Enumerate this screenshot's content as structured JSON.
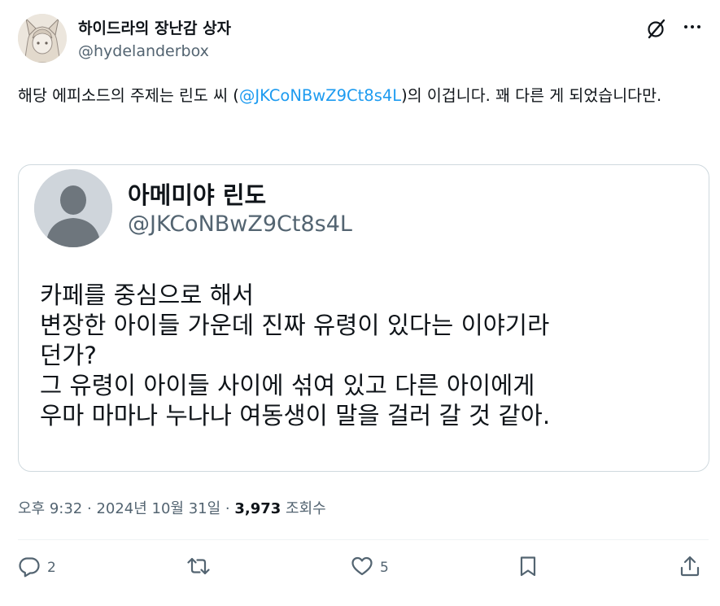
{
  "author": {
    "name": "하이드라의 장난감 상자",
    "handle": "@hydelanderbox"
  },
  "tweet": {
    "text_before": "해당 에피소드의 주제는 린도 씨 (",
    "mention": "@JKCoNBwZ9Ct8s4L",
    "text_after": ")의 이겁니다. 꽤 다른 게 되었습니다만."
  },
  "quote": {
    "name": "아메미야 린도",
    "handle": "@JKCoNBwZ9Ct8s4L",
    "lines": [
      "카페를 중심으로 해서",
      "변장한 아이들 가운데 진짜 유령이 있다는 이야기라",
      "던가?",
      "그 유령이 아이들 사이에 섞여 있고 다른 아이에게",
      "우마 마마나 누나나 여동생이 말을 걸러 갈 것 같아."
    ]
  },
  "meta": {
    "time": "오후 9:32",
    "sep1": " · ",
    "date": "2024년 10월 31일",
    "sep2": " · ",
    "views": "3,973",
    "views_label": " 조회수"
  },
  "actions": {
    "reply_count": "2",
    "like_count": "5"
  },
  "icons": [
    "grok-icon",
    "more-icon",
    "reply-icon",
    "retweet-icon",
    "like-icon",
    "bookmark-icon",
    "share-icon"
  ],
  "colors": {
    "accent": "#1d9bf0",
    "secondary_text": "#536471",
    "border": "#cfd9de"
  }
}
